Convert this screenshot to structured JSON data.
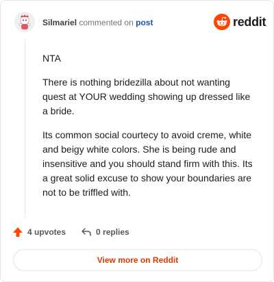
{
  "header": {
    "author": "Silmariel",
    "action_text": "commented on",
    "post_link": "post",
    "brand": "reddit"
  },
  "comment": {
    "paragraphs": [
      "NTA",
      "There is nothing bridezilla about not wanting quest at YOUR wedding showing up dressed like a bride.",
      "Its common social courtecy to avoid creme, white and beigy white colors. She is being rude and insensitive and you should stand firm with this. Its a great solid excuse to show your boundaries are not to be triffled with."
    ]
  },
  "actions": {
    "upvotes": "4 upvotes",
    "replies": "0 replies"
  },
  "footer": {
    "view_more": "View more on Reddit"
  },
  "colors": {
    "brand_orange": "#ff4500",
    "link_blue": "#1b4fb1",
    "view_more_text": "#d93a00"
  },
  "icons": [
    "snoo-avatar-icon",
    "reddit-logo-icon",
    "upvote-arrow-icon",
    "reply-arrow-icon"
  ]
}
